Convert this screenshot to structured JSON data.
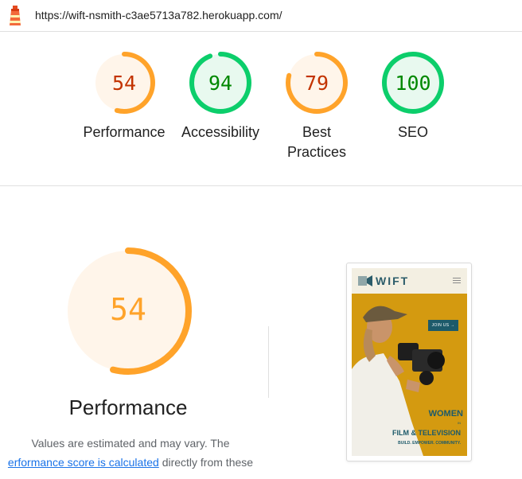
{
  "topbar": {
    "url": "https://wift-nsmith-c3ae5713a782.herokuapp.com/",
    "logo_icon": "lighthouse-icon"
  },
  "gauges": [
    {
      "score": "54",
      "label": "Performance",
      "fraction": 0.54,
      "color": "#ffa32a",
      "text_color": "#c33300",
      "bg": "#fff5ea"
    },
    {
      "score": "94",
      "label": "Accessibility",
      "fraction": 0.94,
      "color": "#0cce6b",
      "text_color": "#008800",
      "bg": "#e8f9ef"
    },
    {
      "score": "79",
      "label": "Best Practices",
      "fraction": 0.79,
      "color": "#ffa32a",
      "text_color": "#c33300",
      "bg": "#fff5ea"
    },
    {
      "score": "100",
      "label": "SEO",
      "fraction": 1.0,
      "color": "#0cce6b",
      "text_color": "#008800",
      "bg": "#e8f9ef"
    }
  ],
  "performance": {
    "score": "54",
    "fraction": 0.54,
    "title": "Performance",
    "desc_prefix": "Values are estimated and may vary. The",
    "desc_link": "erformance score is calculated",
    "desc_suffix": "directly from these"
  },
  "screenshot": {
    "brand": "WIFT",
    "join": "JOIN US →",
    "women": "WOMEN",
    "in": "IN",
    "film": "FILM & TELEVISION",
    "tagline": "BUILD. EMPOWER. COMMUNITY."
  },
  "colors": {
    "pass": "#0cce6b",
    "average": "#ffa32a",
    "link": "#1a73e8"
  }
}
